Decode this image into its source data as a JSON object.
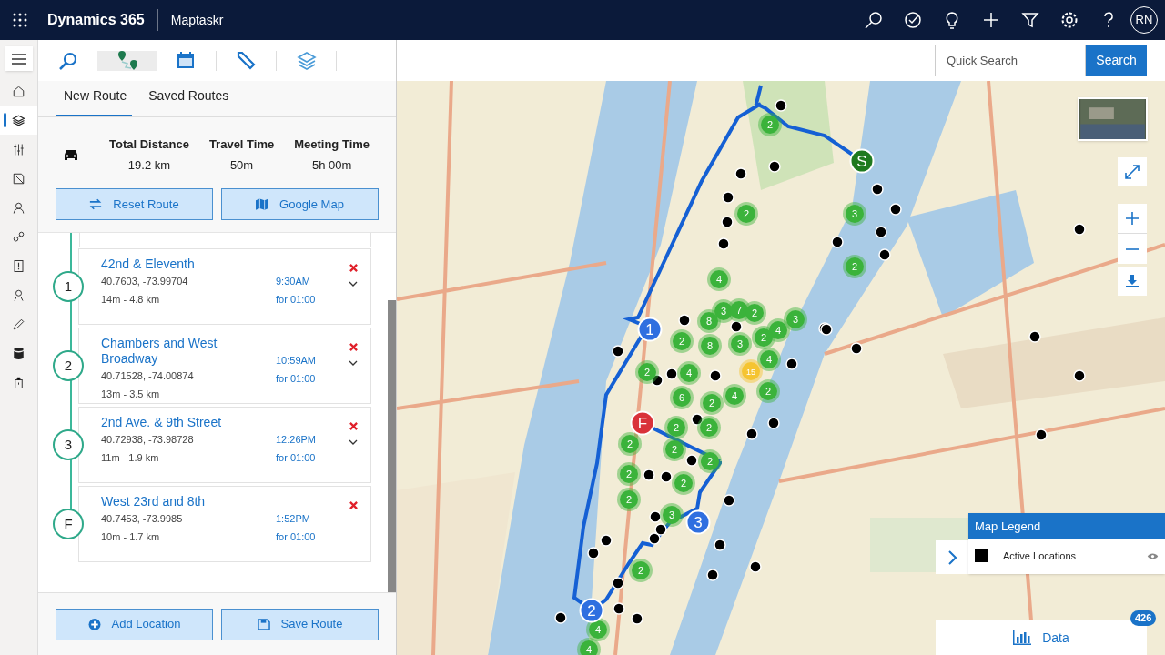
{
  "app": {
    "name": "Dynamics 365",
    "module": "Maptaskr",
    "avatar": "RN"
  },
  "header_icons": [
    {
      "kind": "search"
    },
    {
      "kind": "check"
    },
    {
      "kind": "bulb"
    },
    {
      "kind": "plus"
    },
    {
      "kind": "filter"
    },
    {
      "kind": "gear"
    },
    {
      "kind": "help"
    }
  ],
  "sidebar": [
    {
      "kind": "home",
      "selected": false
    },
    {
      "kind": "layers",
      "selected": true
    },
    {
      "kind": "sliders",
      "selected": false
    },
    {
      "kind": "doc",
      "selected": false
    },
    {
      "kind": "person",
      "selected": false
    },
    {
      "kind": "nodes",
      "selected": false
    },
    {
      "kind": "alert",
      "selected": false
    },
    {
      "kind": "pin-person",
      "selected": false
    },
    {
      "kind": "pencil",
      "selected": false
    },
    {
      "kind": "database",
      "selected": false
    },
    {
      "kind": "lock",
      "selected": false
    }
  ],
  "tool_tabs": [
    {
      "kind": "search",
      "selected": false
    },
    {
      "kind": "route",
      "selected": true
    },
    {
      "kind": "calendar",
      "selected": false
    },
    {
      "kind": "pencil",
      "selected": false
    },
    {
      "kind": "layers",
      "selected": false
    }
  ],
  "route_tabs": [
    {
      "label": "New Route",
      "selected": true
    },
    {
      "label": "Saved Routes",
      "selected": false
    }
  ],
  "summary": [
    {
      "label": "Total Distance",
      "value": "19.2 km"
    },
    {
      "label": "Travel Time",
      "value": "50m"
    },
    {
      "label": "Meeting Time",
      "value": "5h 00m"
    }
  ],
  "actions": [
    {
      "kind": "reset",
      "label": "Reset Route"
    },
    {
      "kind": "map",
      "label": "Google Map"
    }
  ],
  "stops": [
    {
      "marker": "1",
      "name": "42nd & Eleventh",
      "coords": "40.7603, -73.99704",
      "leg": "14m - 4.8 km",
      "time": "9:30AM",
      "duration": "for 01:00",
      "expandable": true
    },
    {
      "marker": "2",
      "name": "Chambers and West Broadway",
      "coords": "40.71528, -74.00874",
      "leg": "13m - 3.5 km",
      "time": "10:59AM",
      "duration": "for 01:00",
      "expandable": true
    },
    {
      "marker": "3",
      "name": "2nd Ave. & 9th Street",
      "coords": "40.72938, -73.98728",
      "leg": "11m - 1.9 km",
      "time": "12:26PM",
      "duration": "for 01:00",
      "expandable": true
    },
    {
      "marker": "F",
      "name": "West 23rd and 8th",
      "coords": "40.7453, -73.9985",
      "leg": "10m - 1.7 km",
      "time": "1:52PM",
      "duration": "for 01:00",
      "expandable": false
    }
  ],
  "footer_actions": [
    {
      "kind": "add",
      "label": "Add Location"
    },
    {
      "kind": "save",
      "label": "Save Route"
    }
  ],
  "search": {
    "placeholder": "Quick Search",
    "button": "Search"
  },
  "map": {
    "pins": [
      {
        "label": "S",
        "color": "#1f7a1f"
      },
      {
        "label": "1",
        "color": "#2f6fe0"
      },
      {
        "label": "F",
        "color": "#d9323a"
      },
      {
        "label": "3",
        "color": "#2f6fe0"
      },
      {
        "label": "2",
        "color": "#2f6fe0"
      }
    ],
    "clusters": [
      {
        "label": "2",
        "color": "#3bb33b"
      },
      {
        "label": "2",
        "color": "#3bb33b"
      },
      {
        "label": "3",
        "color": "#3bb33b"
      },
      {
        "label": "2",
        "color": "#3bb33b"
      },
      {
        "label": "4",
        "color": "#3bb33b"
      },
      {
        "label": "3",
        "color": "#3bb33b"
      },
      {
        "label": "7",
        "color": "#3bb33b"
      },
      {
        "label": "2",
        "color": "#3bb33b"
      },
      {
        "label": "3",
        "color": "#3bb33b"
      },
      {
        "label": "8",
        "color": "#3bb33b"
      },
      {
        "label": "4",
        "color": "#3bb33b"
      },
      {
        "label": "2",
        "color": "#3bb33b"
      },
      {
        "label": "8",
        "color": "#3bb33b"
      },
      {
        "label": "3",
        "color": "#3bb33b"
      },
      {
        "label": "2",
        "color": "#3bb33b"
      },
      {
        "label": "4",
        "color": "#3bb33b"
      },
      {
        "label": "2",
        "color": "#3bb33b"
      },
      {
        "label": "4",
        "color": "#3bb33b"
      },
      {
        "label": "15",
        "color": "#f5c431"
      },
      {
        "label": "2",
        "color": "#3bb33b"
      },
      {
        "label": "6",
        "color": "#3bb33b"
      },
      {
        "label": "2",
        "color": "#3bb33b"
      },
      {
        "label": "4",
        "color": "#3bb33b"
      },
      {
        "label": "2",
        "color": "#3bb33b"
      },
      {
        "label": "2",
        "color": "#3bb33b"
      },
      {
        "label": "2",
        "color": "#3bb33b"
      },
      {
        "label": "2",
        "color": "#3bb33b"
      },
      {
        "label": "2",
        "color": "#3bb33b"
      },
      {
        "label": "2",
        "color": "#3bb33b"
      },
      {
        "label": "2",
        "color": "#3bb33b"
      },
      {
        "label": "2",
        "color": "#3bb33b"
      },
      {
        "label": "3",
        "color": "#3bb33b"
      },
      {
        "label": "2",
        "color": "#3bb33b"
      },
      {
        "label": "4",
        "color": "#3bb33b"
      },
      {
        "label": "4",
        "color": "#3bb33b"
      }
    ]
  },
  "legend": {
    "title": "Map Legend",
    "items": [
      {
        "label": "Active Locations",
        "color": "#000000"
      }
    ]
  },
  "data_button": {
    "label": "Data",
    "count": "426"
  }
}
